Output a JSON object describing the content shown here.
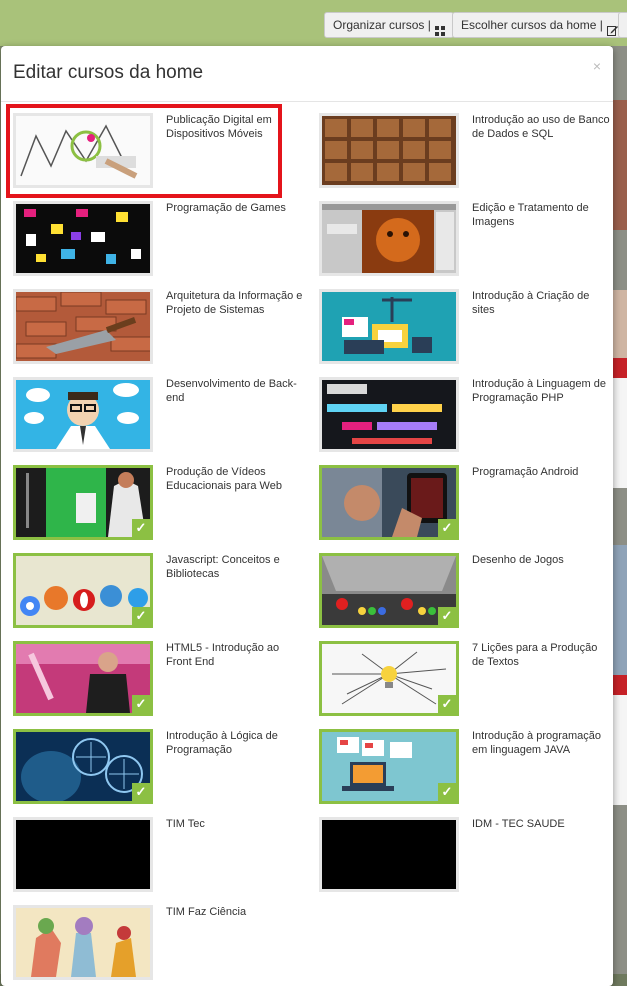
{
  "toolbar": {
    "organize_label": "Organizar cursos |",
    "choose_label": "Escolher cursos da home |"
  },
  "modal": {
    "title": "Editar cursos da home",
    "close": "×"
  },
  "courses": [
    {
      "title": "Publicação Digital em Dispositivos Móveis",
      "selected": false
    },
    {
      "title": "Introdução ao uso de Banco de Dados e SQL",
      "selected": false
    },
    {
      "title": "Programação de Games",
      "selected": false
    },
    {
      "title": "Edição e Tratamento de Imagens",
      "selected": false
    },
    {
      "title": "Arquitetura da Informação e Projeto de Sistemas",
      "selected": false
    },
    {
      "title": "Introdução à Criação de sites",
      "selected": false
    },
    {
      "title": "Desenvolvimento de Back-end",
      "selected": false
    },
    {
      "title": "Introdução à Linguagem de Programação PHP",
      "selected": false
    },
    {
      "title": "Produção de Vídeos Educacionais para Web",
      "selected": true
    },
    {
      "title": "Programação Android",
      "selected": true
    },
    {
      "title": "Javascript: Conceitos e Bibliotecas",
      "selected": true
    },
    {
      "title": "Desenho de Jogos",
      "selected": true
    },
    {
      "title": "HTML5 - Introdução ao Front End",
      "selected": true
    },
    {
      "title": "7 Lições para a Produção de Textos",
      "selected": true
    },
    {
      "title": "Introdução à Lógica de Programação",
      "selected": true
    },
    {
      "title": "Introdução à programação em linguagem JAVA",
      "selected": true
    },
    {
      "title": "TIM Tec",
      "selected": false
    },
    {
      "title": "IDM - TEC SAUDE",
      "selected": false
    },
    {
      "title": "TIM Faz Ciência",
      "selected": false
    }
  ],
  "colors": {
    "selected_border": "#8cc043",
    "highlight": "#e4141b",
    "topbar": "#a9c27a"
  }
}
